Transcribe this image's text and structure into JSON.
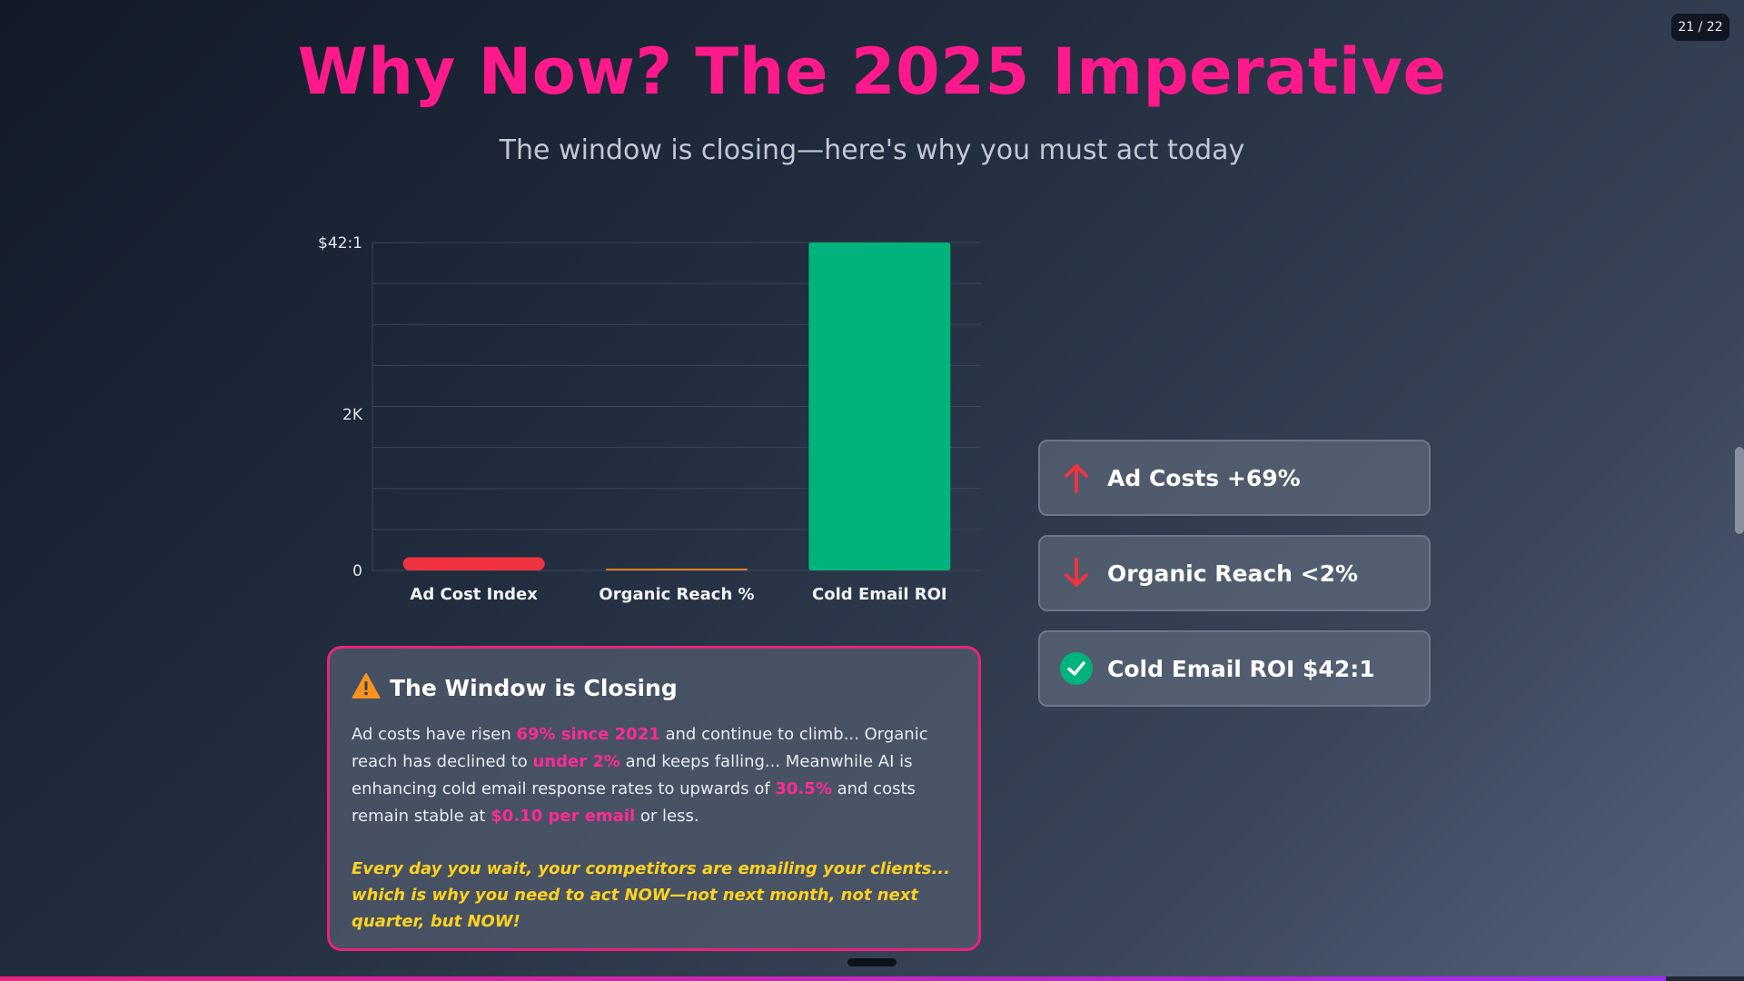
{
  "page_counter": "21 / 22",
  "slide": {
    "title": "Why Now? The 2025 Imperative",
    "subtitle": "The window is closing—here's why you must act today"
  },
  "chart_data": {
    "type": "bar",
    "categories": [
      "Ad Cost Index",
      "Organic Reach %",
      "Cold Email ROI"
    ],
    "values": [
      169,
      2,
      4200
    ],
    "colors": [
      "#ef3340",
      "#e67e22",
      "#00b37a"
    ],
    "y_tick_labels": [
      {
        "label": "0",
        "value": 0
      },
      {
        "label": "2K",
        "value": 2000
      },
      {
        "label": "$42:1",
        "value": 4200
      }
    ],
    "ylim": [
      0,
      4200
    ],
    "grid": true,
    "title": "",
    "xlabel": "",
    "ylabel": ""
  },
  "legend_cards": [
    {
      "icon": "arrow-up-icon",
      "label": "Ad Costs +69%",
      "color": "#ef3340"
    },
    {
      "icon": "arrow-down-icon",
      "label": "Organic Reach <2%",
      "color": "#ef3340"
    },
    {
      "icon": "check-circle-icon",
      "label": "Cold Email ROI $42:1",
      "color": "#00b37a"
    }
  ],
  "warning": {
    "icon": "warning-triangle-icon",
    "title": "The Window is Closing",
    "p1_a": "Ad costs have risen ",
    "p1_hl1": "69% since 2021",
    "p1_b": " and continue to climb... Organic reach has declined to ",
    "p1_hl2": "under 2%",
    "p1_c": " and keeps falling... Meanwhile AI is enhancing cold email response rates to upwards of ",
    "p1_hl3": "30.5%",
    "p1_d": " and costs remain stable at ",
    "p1_hl4": "$0.10 per email",
    "p1_e": " or less.",
    "urgent": "Every day you wait, your competitors are emailing your clients... which is why you need to act NOW—not next month, not next quarter, but NOW!"
  },
  "progress": 0.955
}
